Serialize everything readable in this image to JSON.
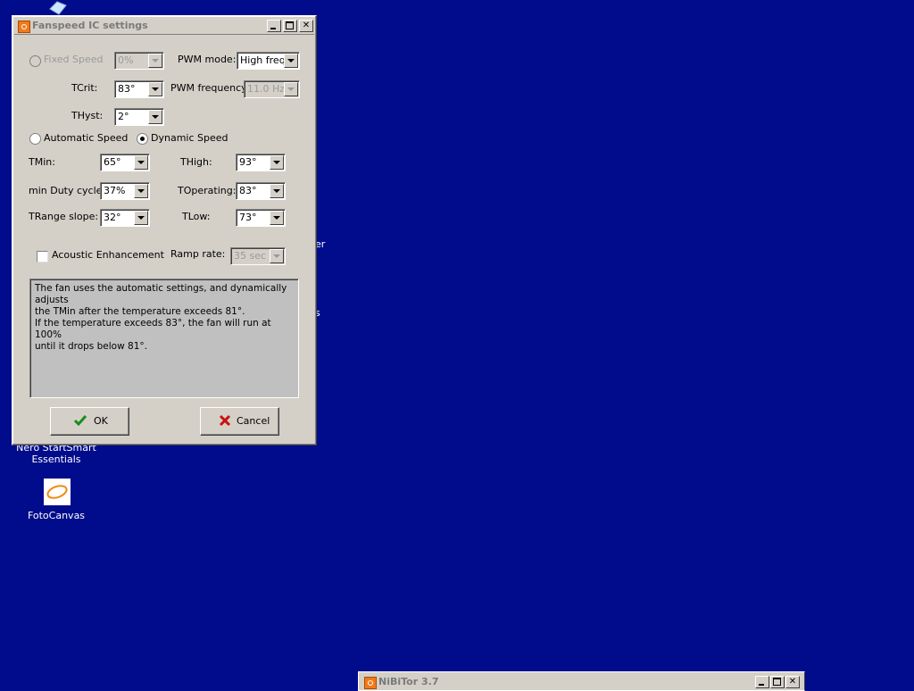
{
  "colors": {
    "desktop": "#000c8c",
    "dialog_bg": "#d4d0c8",
    "ok_check": "#1a8c1a",
    "cancel_x": "#cc1010"
  },
  "desktop": {
    "icons": [
      {
        "name": "nero-startsmart",
        "label": "Nero StartSmart\nEssentials"
      },
      {
        "name": "fotocanvas",
        "label": "FotoCanvas"
      }
    ],
    "partial_text": [
      "er",
      "s"
    ]
  },
  "dialog": {
    "title": "Fanspeed IC settings",
    "fixed_speed": {
      "label": "Fixed Speed",
      "value": "0%"
    },
    "pwm_mode": {
      "label": "PWM mode:",
      "value": "High freq"
    },
    "tcrit": {
      "label": "TCrit:",
      "value": "83°"
    },
    "pwm_frequency": {
      "label": "PWM frequency:",
      "value": "11.0 Hz"
    },
    "thyst": {
      "label": "THyst:",
      "value": "2°"
    },
    "automatic_speed": {
      "label": "Automatic Speed"
    },
    "dynamic_speed": {
      "label": "Dynamic Speed"
    },
    "tmin": {
      "label": "TMin:",
      "value": "65°"
    },
    "thigh": {
      "label": "THigh:",
      "value": "93°"
    },
    "min_duty": {
      "label": "min Duty cycle:",
      "value": "37%"
    },
    "toperating": {
      "label": "TOperating:",
      "value": "83°"
    },
    "trange": {
      "label": "TRange slope:",
      "value": "32°"
    },
    "tlow": {
      "label": "TLow:",
      "value": "73°"
    },
    "acoustic": {
      "label": "Acoustic Enhancement"
    },
    "ramp_rate": {
      "label": "Ramp rate:",
      "value": "35 sec"
    },
    "description": {
      "line1": "The fan uses the automatic settings, and dynamically adjusts",
      "line2": "the TMin after the temperature exceeds 81°.",
      "line3": "If the temperature exceeds 83°, the fan will run at 100%",
      "line4": "until it drops below 81°."
    },
    "ok_label": "OK",
    "cancel_label": "Cancel"
  },
  "taskbar_window": {
    "title": "NiBiTor 3.7"
  }
}
